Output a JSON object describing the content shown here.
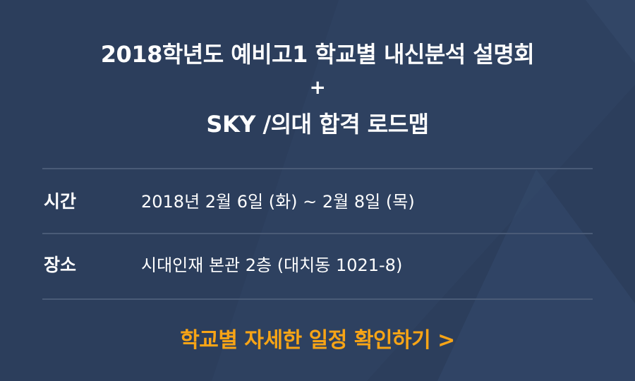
{
  "header": {
    "title_line1": "2018학년도 예비고1 학교별 내신분석 설명회",
    "plus": "+",
    "title_line2": "SKY /의대 합격 로드맵"
  },
  "info": {
    "time_label": "시간",
    "time_value": "2018년 2월 6일 (화) ~ 2월 8일 (목)",
    "place_label": "장소",
    "place_value": "시대인재 본관 2층 (대치동 1021-8)"
  },
  "cta": {
    "label": "학교별 자세한 일정 확인하기 >"
  },
  "colors": {
    "background": "#2c3e5c",
    "accent": "#f7a416",
    "divider": "#4a5b77",
    "text": "#ffffff"
  }
}
